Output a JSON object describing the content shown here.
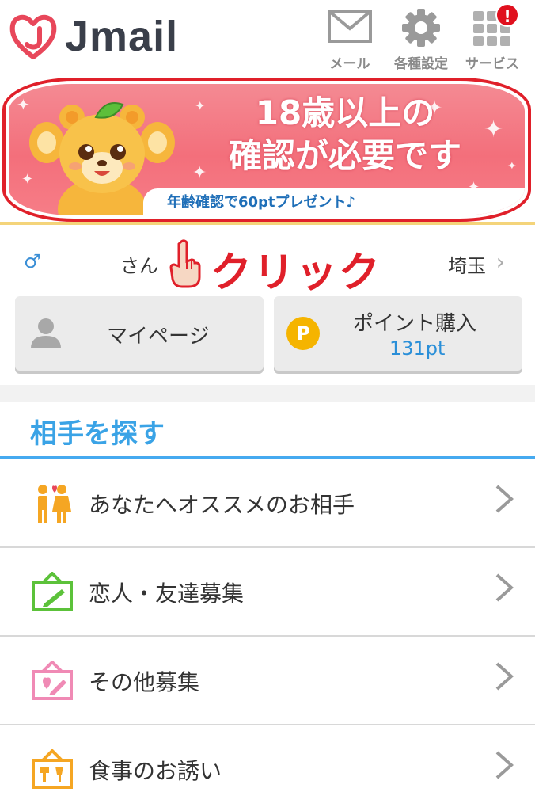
{
  "header": {
    "logo_text": "Jmail",
    "nav": [
      {
        "label": "メール",
        "icon": "mail-icon"
      },
      {
        "label": "各種設定",
        "icon": "gear-icon"
      },
      {
        "label": "サービス",
        "icon": "grid-icon",
        "badge": "!"
      }
    ]
  },
  "banner": {
    "title_line1": "18歳以上の",
    "title_line2": "確認が必要です",
    "subtitle": "年齢確認で60ptプレゼント♪"
  },
  "user": {
    "gender_symbol": "♂",
    "honorific": "さん",
    "click_label": "クリック",
    "prefecture": "埼玉",
    "prefecture_chevron": "›"
  },
  "buttons": {
    "mypage_label": "マイページ",
    "points_label": "ポイント購入",
    "points_coin": "P",
    "points_value": "131pt"
  },
  "section": {
    "title": "相手を探す",
    "items": [
      {
        "label": "あなたへオススメのお相手",
        "icon": "couple-icon"
      },
      {
        "label": "恋人・友達募集",
        "icon": "green-board-icon"
      },
      {
        "label": "その他募集",
        "icon": "pink-board-icon"
      },
      {
        "label": "食事のお誘い",
        "icon": "dining-board-icon"
      }
    ]
  },
  "colors": {
    "accent_blue": "#3aa3e6",
    "alert_red": "#e0202a",
    "banner_pink": "#f36f7b",
    "point_blue": "#2a8fd8",
    "coin_yellow": "#f5b400"
  }
}
